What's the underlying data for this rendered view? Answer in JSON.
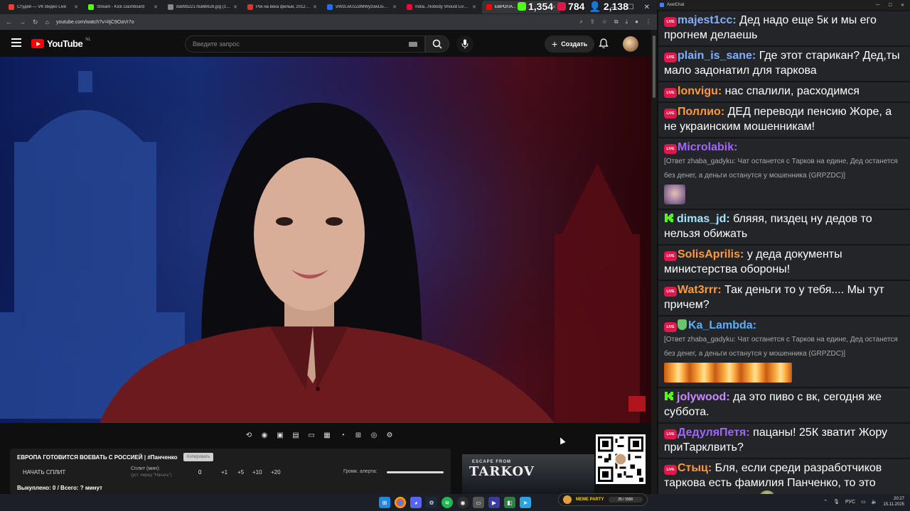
{
  "browser": {
    "tabs": [
      {
        "title": "Студия — VK Видео Live",
        "color": "#ff3b30",
        "active": false
      },
      {
        "title": "Stream - Kick Dashboard",
        "color": "#53fc18",
        "active": false
      },
      {
        "title": "da99b2217ba6b628.jpg (13...",
        "color": "#888888",
        "active": false
      },
      {
        "title": "Рок на века фильм, 2012, д...",
        "color": "#d03a2a",
        "active": false
      },
      {
        "title": "vlWzLwU2ZdMWyzuwLluQp...",
        "color": "#1e6fff",
        "active": false
      },
      {
        "title": "India...Nobody Should Live I...",
        "color": "#ff0033",
        "active": false
      },
      {
        "title": "ЕВРОПА...",
        "color": "#ff0000",
        "active": true
      }
    ],
    "url": "youtube.com/watch?v=itjC9OaVr7o"
  },
  "stats": {
    "kick": "1,354",
    "live": "784",
    "viewers": "2,138"
  },
  "youtube": {
    "logo_text": "YouTube",
    "country": "NL",
    "search_placeholder": "Введите запрос",
    "create_label": "Создать"
  },
  "panel": {
    "title": "ЕВРОПА ГОТОВИТСЯ ВОЕВАТЬ С РОССИЕЙ | #Панченко",
    "badge": "Копировать",
    "split_button": "НАЧАТЬ СПЛИТ",
    "split_minutes_label": "Сплит (мин):",
    "split_minutes_sub": "(уст. перед \"Начать\")",
    "split_value": "0",
    "increments": [
      "+1",
      "+5",
      "+10",
      "+20"
    ],
    "volume_label": "Громк. алерта:",
    "volume_level": 1.0,
    "bought": "Выкуплено: 0 / Всего: ? минут"
  },
  "overlay": {
    "tarkov_top": "ESCAPE FROM",
    "tarkov_main": "TARKOV",
    "meme_party": "MEME PARTY",
    "meme_progress": "25 / 1500"
  },
  "taskbar": {
    "lang": "РУС",
    "time": "20:27",
    "date": "15.11.2025"
  },
  "chat": {
    "window_title": "AxelChat",
    "messages": [
      {
        "platform": "live",
        "name": "majest1cc",
        "color": "#7fb0ff",
        "text": "Дед надо еще 5к и мы его прогнем делаешь"
      },
      {
        "platform": "live",
        "name": "plain_is_sane",
        "color": "#7fb0ff",
        "text": "Где этот старикан? Дед,ты мало задонатил для таркова"
      },
      {
        "platform": "live",
        "name": "lonvigu",
        "color": "#ff9a3c",
        "text": "нас спалили, расходимся"
      },
      {
        "platform": "live",
        "name": "Поллио",
        "color": "#ff9a3c",
        "text": "ДЕД переводи пенсию Жоре, а не украинским мошенникам!"
      },
      {
        "platform": "live",
        "name": "Microlabik",
        "color": "#a066ff",
        "text": "",
        "reply": "[Ответ zhaba_gadyku: Чат останется с Тарков на едине, Дед останется без денег, а деньги останутся у мошенника (GRPZDC)]",
        "emote": "face"
      },
      {
        "platform": "kick",
        "name": "dimas_jd",
        "color": "#a3e6ff",
        "text": "бляяя, пиздец ну дедов то нельзя обижать"
      },
      {
        "platform": "live",
        "name": "SolisAprilis",
        "color": "#ff9a3c",
        "text": "у деда документы министерства обороны!"
      },
      {
        "platform": "live",
        "name": "Wat3rrr",
        "color": "#ff9a3c",
        "text": "Так деньги то у тебя.... Мы тут причем?"
      },
      {
        "platform": "live",
        "name": "Ka_Lambda",
        "color": "#5ab0ff",
        "text": "",
        "shield": true,
        "reply": "[Ответ zhaba_gadyku: Чат останется с Тарков на едине, Дед останется без денег, а деньги останутся у мошенника (GRPZDC)]",
        "emote": "wide"
      },
      {
        "platform": "kick",
        "name": "jolywood",
        "color": "#c98aff",
        "text": "да это пиво с вк, сегодня же суббота."
      },
      {
        "platform": "live",
        "name": "ДедуляПетя",
        "color": "#a066ff",
        "text": "пацаны! 25К зватит Жору приТарклвить?"
      },
      {
        "platform": "live",
        "name": "Стыц",
        "color": "#ff9a3c",
        "text": "Бля, если среди разработчиков таркова есть фамилия Панченко, то это тарков на стриме",
        "emote": "frog"
      }
    ]
  }
}
